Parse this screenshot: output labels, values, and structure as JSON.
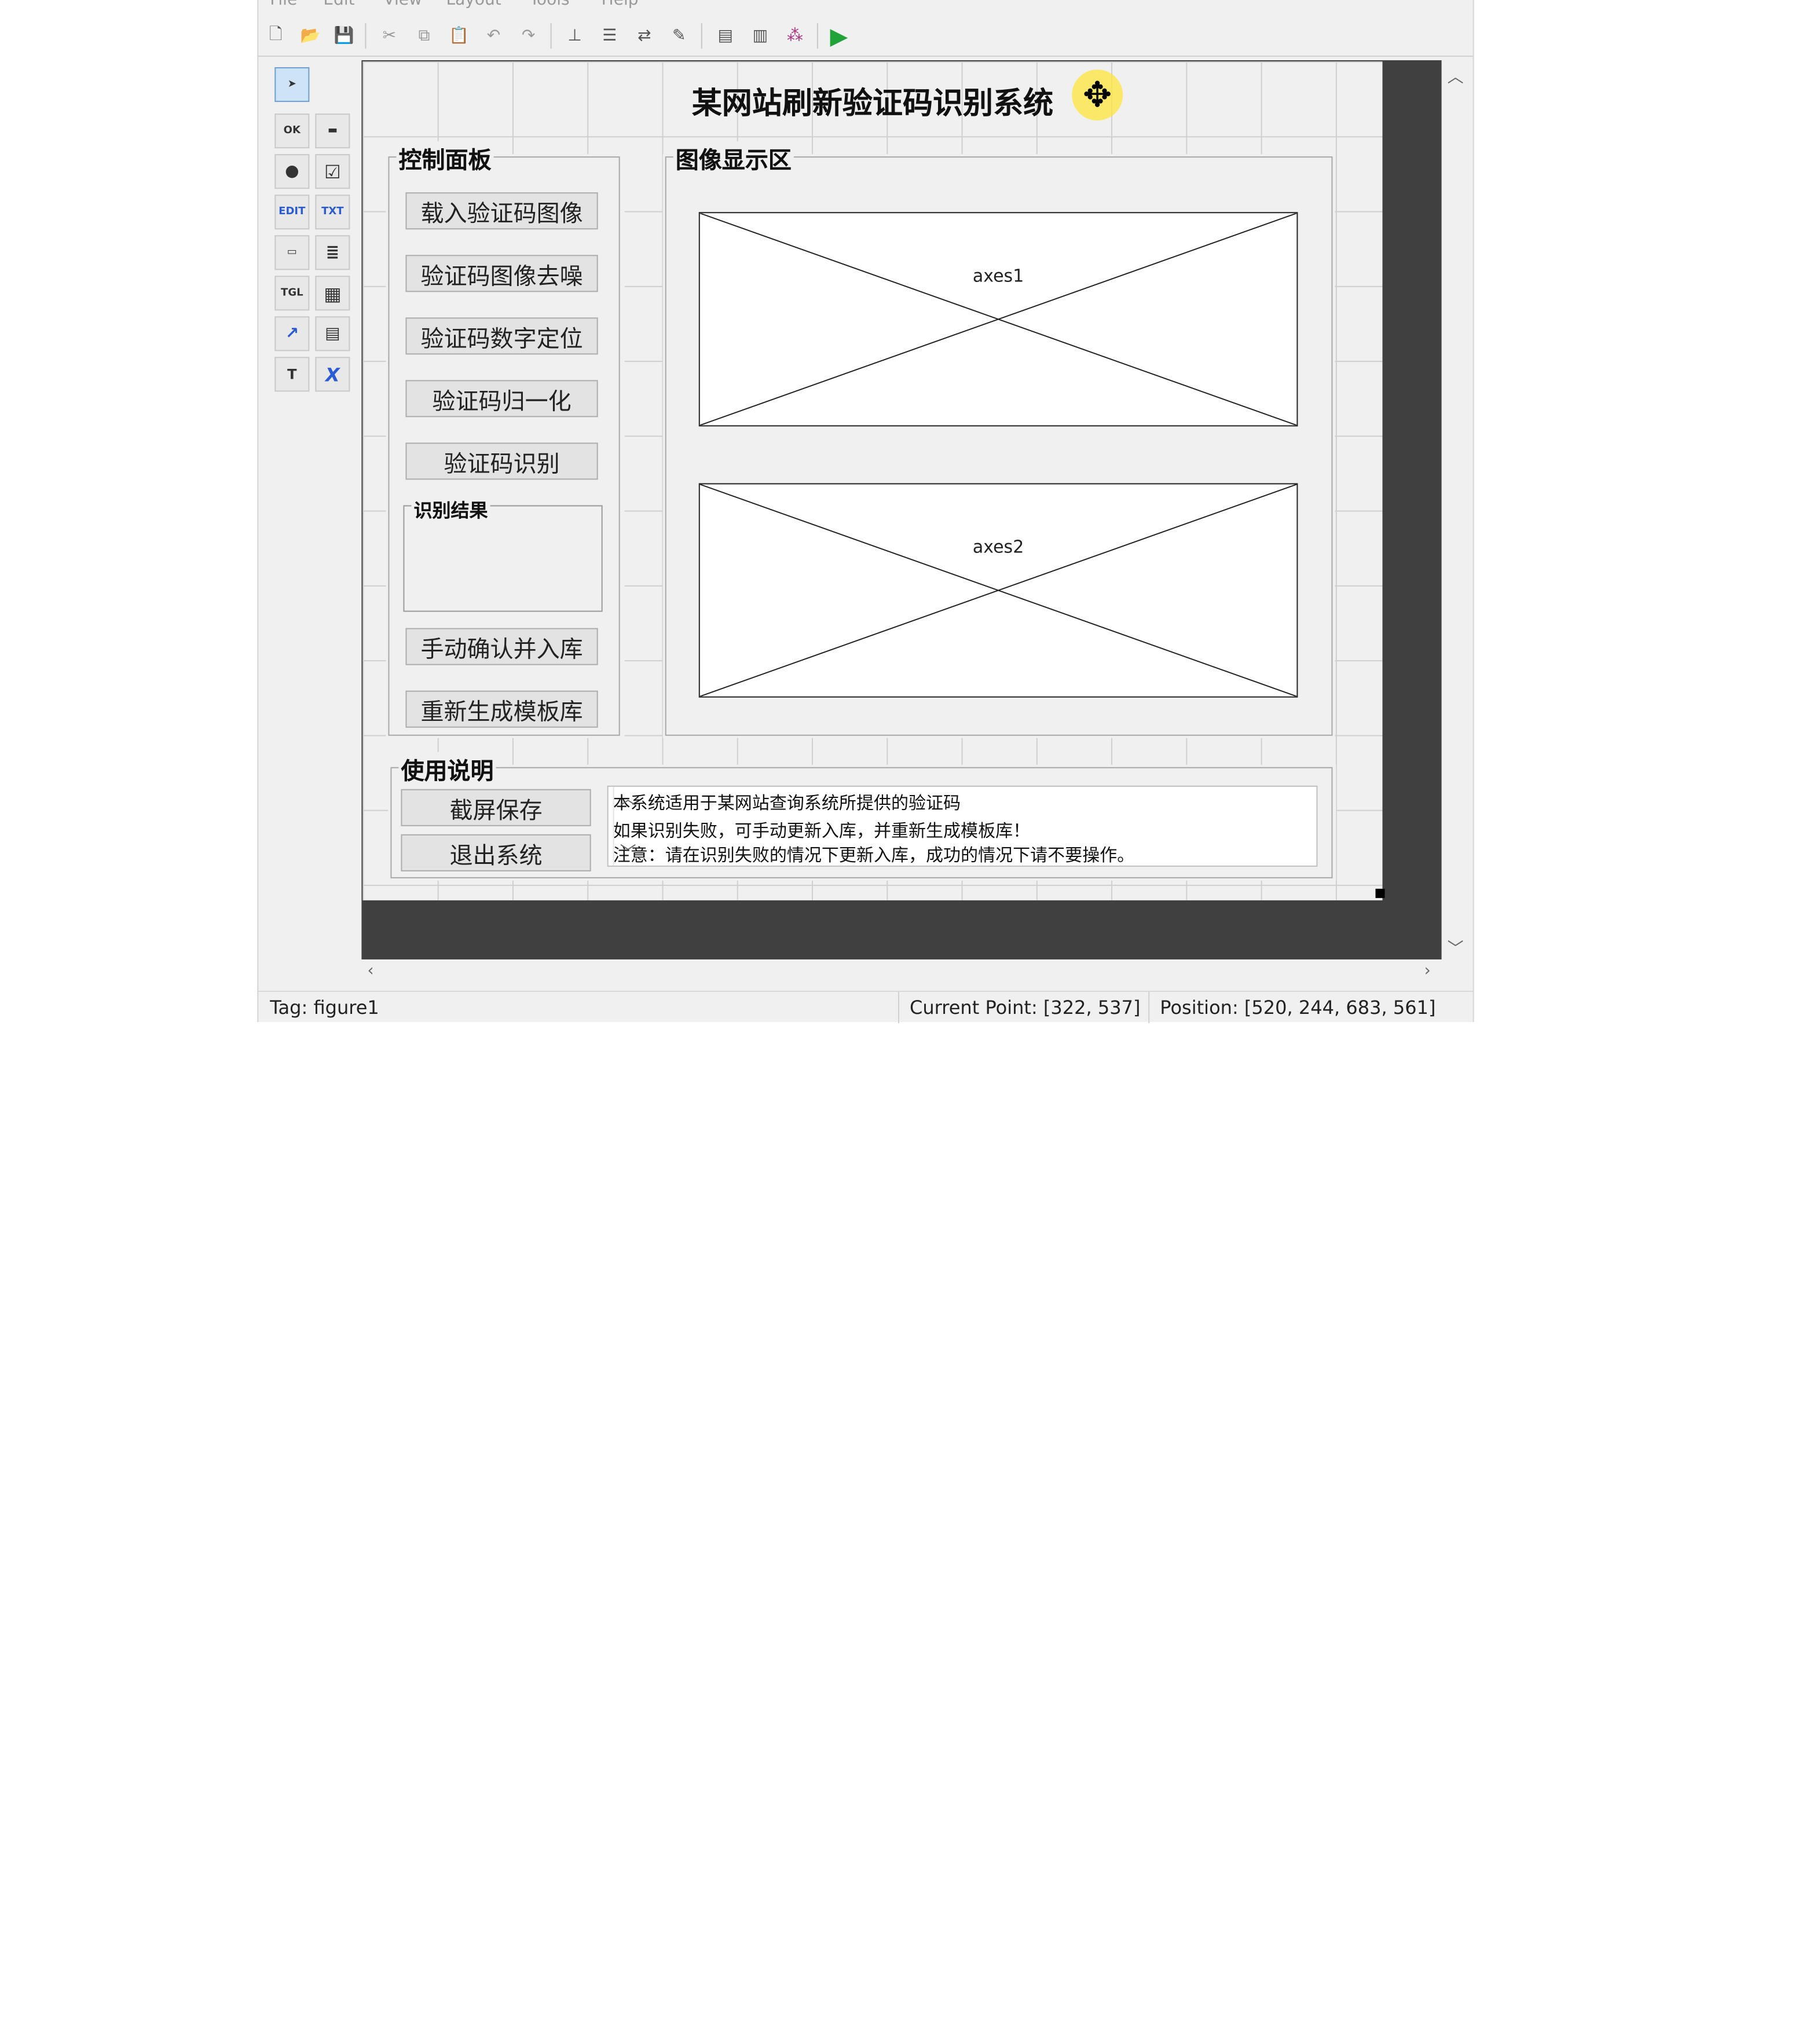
{
  "menu": [
    "File",
    "Edit",
    "View",
    "Layout",
    "Tools",
    "Help"
  ],
  "toolbar_icons": [
    "new-file-icon",
    "open-folder-icon",
    "save-icon",
    "cut-icon",
    "copy-icon",
    "paste-icon",
    "undo-icon",
    "redo-icon",
    "align-icon",
    "menu-editor-icon",
    "tab-order-icon",
    "toolbar-editor-icon",
    "mfile-editor-icon",
    "property-inspector-icon",
    "object-browser-icon",
    "run-icon"
  ],
  "palette_icons": [
    {
      "name": "select-tool-icon",
      "label": "➤"
    },
    {
      "name": "push-button-tool-icon",
      "label": "OK"
    },
    {
      "name": "slider-tool-icon",
      "label": "▬"
    },
    {
      "name": "radio-button-tool-icon",
      "label": "●"
    },
    {
      "name": "checkbox-tool-icon",
      "label": "☑"
    },
    {
      "name": "edit-text-tool-icon",
      "label": "EDIT"
    },
    {
      "name": "static-text-tool-icon",
      "label": "TXT"
    },
    {
      "name": "popup-menu-tool-icon",
      "label": "▭"
    },
    {
      "name": "listbox-tool-icon",
      "label": "≣"
    },
    {
      "name": "toggle-button-tool-icon",
      "label": "TGL"
    },
    {
      "name": "table-tool-icon",
      "label": "▦"
    },
    {
      "name": "axes-tool-icon",
      "label": "📈"
    },
    {
      "name": "panel-tool-icon",
      "label": "▤"
    },
    {
      "name": "button-group-tool-icon",
      "label": "T"
    },
    {
      "name": "activex-tool-icon",
      "label": "X"
    }
  ],
  "figure": {
    "title": "某网站刷新验证码识别系统",
    "control_panel": {
      "title": "控制面板",
      "buttons": [
        "载入验证码图像",
        "验证码图像去噪",
        "验证码数字定位",
        "验证码归一化",
        "验证码识别"
      ],
      "result_title": "识别结果",
      "buttons2": [
        "手动确认并入库",
        "重新生成模板库"
      ]
    },
    "image_panel": {
      "title": "图像显示区",
      "axes1": "axes1",
      "axes2": "axes2"
    },
    "usage_panel": {
      "title": "使用说明",
      "buttons": [
        "截屏保存",
        "退出系统"
      ],
      "text_lines": [
        "本系统适用于某网站查询系统所提供的验证码",
        "如果识别失败，可手动更新入库，并重新生成模板库！",
        "注意：请在识别失败的情况下更新入库，成功的情况下请不要操作。"
      ]
    }
  },
  "status": {
    "tag": "Tag: figure1",
    "current_point": "Current Point:  [322, 537]",
    "position": "Position: [520, 244, 683, 561]"
  }
}
